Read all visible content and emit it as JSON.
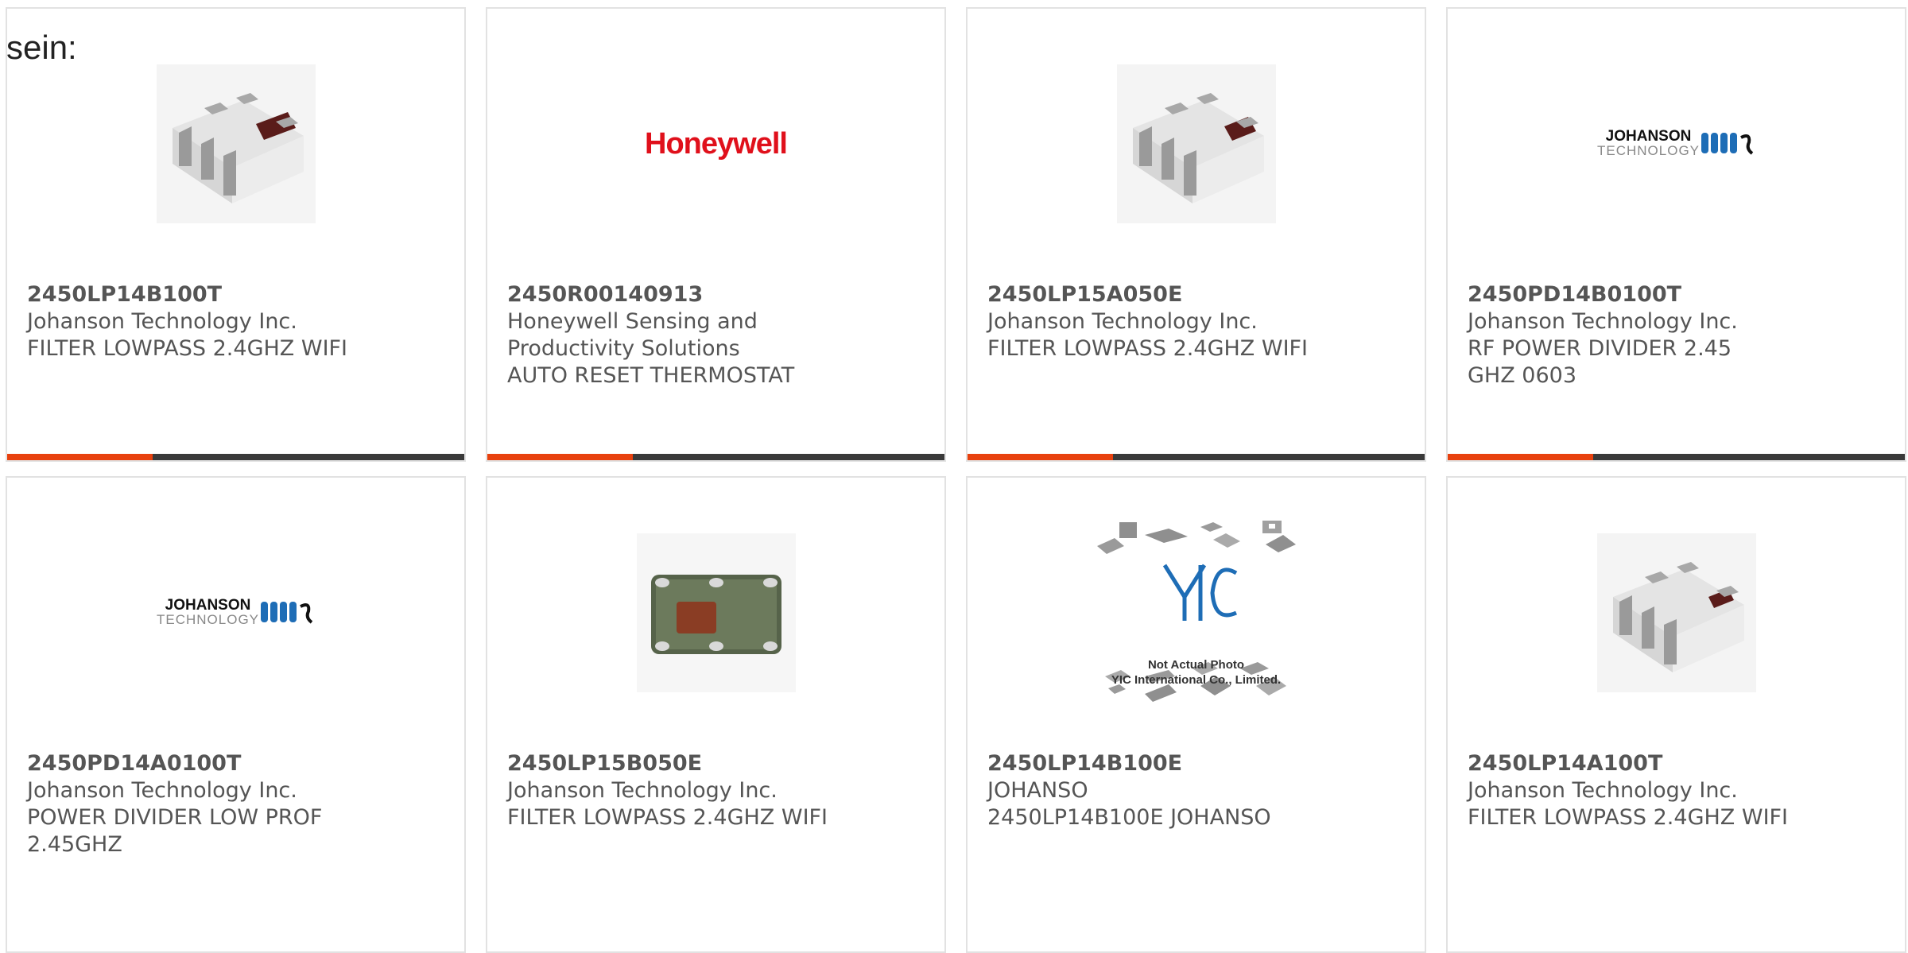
{
  "intro_text": "sein:",
  "products": [
    {
      "part": "2450LP14B100T",
      "manufacturer": "Johanson Technology Inc.",
      "description": "FILTER LOWPASS 2.4GHZ WIFI",
      "image": "ceramic-chip-filter-3d"
    },
    {
      "part": "2450R00140913",
      "manufacturer": "Honeywell Sensing and Productivity Solutions",
      "description": "AUTO RESET THERMOSTAT",
      "image": "honeywell-logo",
      "logo_text": "Honeywell"
    },
    {
      "part": "2450LP15A050E",
      "manufacturer": "Johanson Technology Inc.",
      "description": "FILTER LOWPASS 2.4GHZ WIFI",
      "image": "ceramic-chip-filter-3d"
    },
    {
      "part": "2450PD14B0100T",
      "manufacturer": "Johanson Technology Inc.",
      "description": "RF POWER DIVIDER 2.45 GHZ 0603",
      "image": "johanson-logo",
      "logo_line1": "JOHANSON",
      "logo_line2": "TECHNOLOGY"
    },
    {
      "part": "2450PD14A0100T",
      "manufacturer": "Johanson Technology Inc.",
      "description": "POWER DIVIDER LOW PROF 2.45GHZ",
      "image": "johanson-logo",
      "logo_line1": "JOHANSON",
      "logo_line2": "TECHNOLOGY"
    },
    {
      "part": "2450LP15B050E",
      "manufacturer": "Johanson Technology Inc.",
      "description": "FILTER LOWPASS 2.4GHZ WIFI",
      "image": "ceramic-chip-top"
    },
    {
      "part": "2450LP14B100E",
      "manufacturer": "JOHANSO",
      "description": "2450LP14B100E JOHANSO",
      "image": "yic-placeholder",
      "logo_line1": "Not Actual Photo",
      "logo_line2": "YIC International Co., Limited."
    },
    {
      "part": "2450LP14A100T",
      "manufacturer": "Johanson Technology Inc.",
      "description": "FILTER LOWPASS 2.4GHZ WIFI",
      "image": "ceramic-chip-filter-3d"
    }
  ],
  "colors": {
    "accent": "#e8410e",
    "bar": "#3a3a3a",
    "honeywell_red": "#e0101b",
    "johanson_blue": "#1e6db6"
  }
}
